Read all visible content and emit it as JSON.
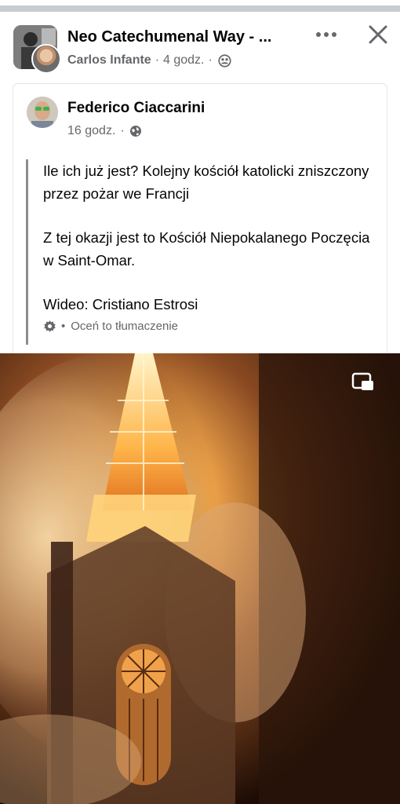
{
  "header": {
    "group_title": "Neo Catechumenal Way - ...",
    "author": "Carlos Infante",
    "time": "4 godz.",
    "separator": "·",
    "audience_icon": "friends-icon",
    "more_icon": "more-dots-icon",
    "close_icon": "close-icon"
  },
  "shared_post": {
    "author": "Federico Ciaccarini",
    "time": "16 godz.",
    "separator": "·",
    "audience_icon": "globe-icon",
    "paragraphs": [
      "Ile ich już jest? Kolejny kościół katolicki zniszczony przez pożar we Francji",
      "Z tej okazji jest to Kościół Niepokalanego Poczęcia w Saint-Omar.",
      "Wideo: Cristiano Estrosi"
    ],
    "translation_label": "Oceń to tłumaczenie",
    "translation_separator": "•"
  },
  "video": {
    "pip_icon": "picture-in-picture-icon"
  }
}
